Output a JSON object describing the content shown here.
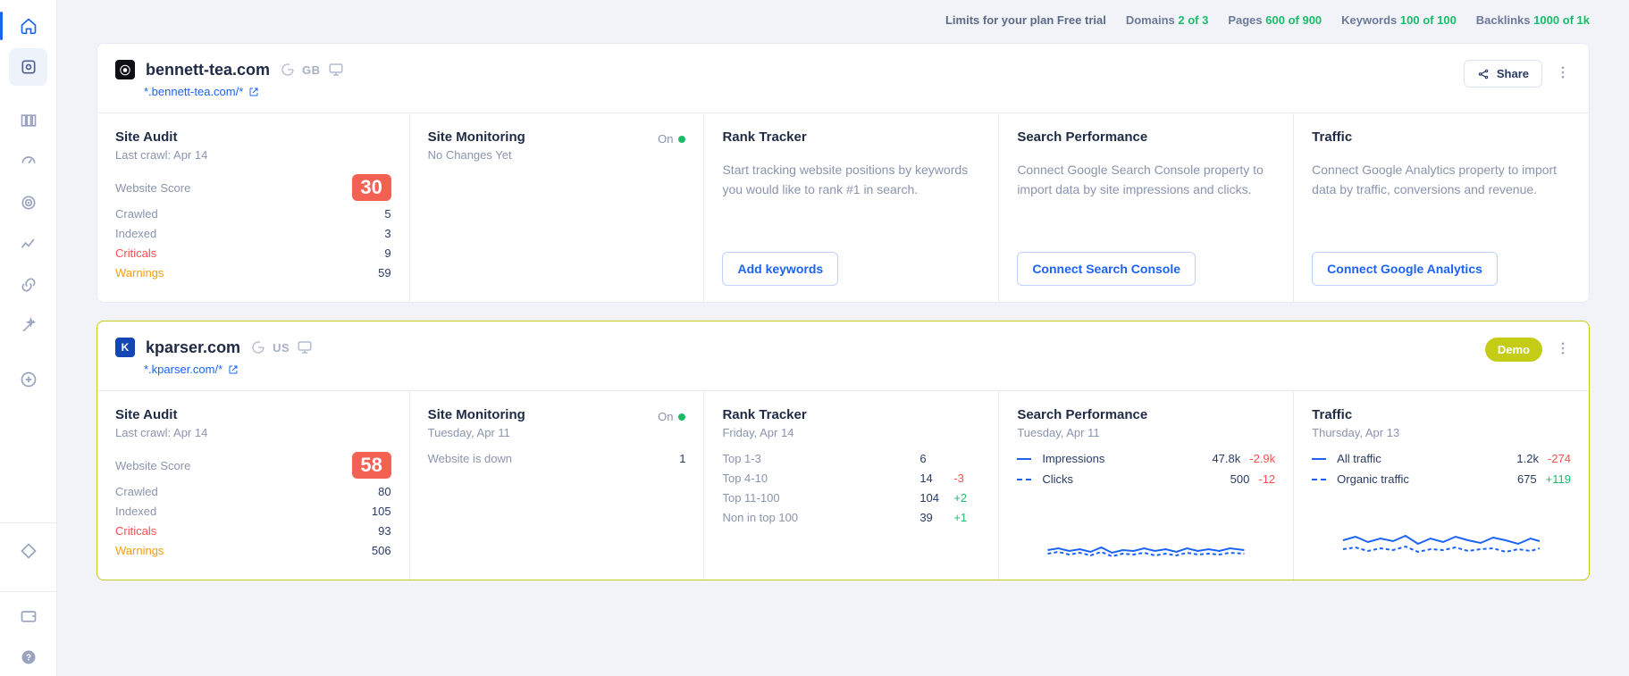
{
  "limits": {
    "lead": "Limits for your plan Free trial",
    "domains_label": "Domains",
    "domains_val": "2 of 3",
    "pages_label": "Pages",
    "pages_val": "600 of 900",
    "keywords_label": "Keywords",
    "keywords_val": "100 of 100",
    "backlinks_label": "Backlinks",
    "backlinks_val": "1000 of 1k"
  },
  "share_label": "Share",
  "cards": [
    {
      "favicon": "⦿",
      "domain": "bennett-tea.com",
      "country": "GB",
      "subdomain": "*.bennett-tea.com/*",
      "badge": null,
      "site_audit": {
        "title": "Site Audit",
        "sub": "Last crawl: Apr 14",
        "score_label": "Website Score",
        "score": "30",
        "crawled_label": "Crawled",
        "crawled": "5",
        "indexed_label": "Indexed",
        "indexed": "3",
        "criticals_label": "Criticals",
        "criticals": "9",
        "warnings_label": "Warnings",
        "warnings": "59"
      },
      "monitoring": {
        "title": "Site Monitoring",
        "status": "On",
        "sub": "No Changes Yet"
      },
      "rank": {
        "title": "Rank Tracker",
        "desc": "Start tracking website positions by keywords you would like to rank #1 in search.",
        "cta": "Add keywords"
      },
      "search": {
        "title": "Search Performance",
        "desc": "Connect Google Search Console property to import data by site impressions and clicks.",
        "cta": "Connect Search Console"
      },
      "traffic": {
        "title": "Traffic",
        "desc": "Connect Google Analytics property to import data by traffic, conversions and revenue.",
        "cta": "Connect Google Analytics"
      }
    },
    {
      "favicon": "K",
      "domain": "kparser.com",
      "country": "US",
      "subdomain": "*.kparser.com/*",
      "badge": "Demo",
      "site_audit": {
        "title": "Site Audit",
        "sub": "Last crawl: Apr 14",
        "score_label": "Website Score",
        "score": "58",
        "crawled_label": "Crawled",
        "crawled": "80",
        "indexed_label": "Indexed",
        "indexed": "105",
        "criticals_label": "Criticals",
        "criticals": "93",
        "warnings_label": "Warnings",
        "warnings": "506"
      },
      "monitoring": {
        "title": "Site Monitoring",
        "status": "On",
        "sub": "Tuesday, Apr 11",
        "row_label": "Website is down",
        "row_val": "1"
      },
      "rank": {
        "title": "Rank Tracker",
        "sub": "Friday, Apr 14",
        "rows": [
          {
            "label": "Top 1-3",
            "val": "6",
            "delta": ""
          },
          {
            "label": "Top 4-10",
            "val": "14",
            "delta": "-3"
          },
          {
            "label": "Top 11-100",
            "val": "104",
            "delta": "+2"
          },
          {
            "label": "Non in top 100",
            "val": "39",
            "delta": "+1"
          }
        ]
      },
      "search": {
        "title": "Search Performance",
        "sub": "Tuesday, Apr 11",
        "impressions_label": "Impressions",
        "impressions": "47.8k",
        "impressions_delta": "-2.9k",
        "clicks_label": "Clicks",
        "clicks": "500",
        "clicks_delta": "-12"
      },
      "traffic": {
        "title": "Traffic",
        "sub": "Thursday, Apr 13",
        "all_label": "All traffic",
        "all": "1.2k",
        "all_delta": "-274",
        "organic_label": "Organic traffic",
        "organic": "675",
        "organic_delta": "+119"
      }
    }
  ],
  "chart_data": [
    {
      "type": "line",
      "title": "Search Performance",
      "x": [
        1,
        2,
        3,
        4,
        5,
        6,
        7,
        8,
        9,
        10,
        11,
        12,
        13,
        14,
        15,
        16,
        17,
        18,
        19,
        20
      ],
      "series": [
        {
          "name": "Impressions",
          "values": [
            45,
            44,
            47,
            46,
            48,
            46,
            50,
            48,
            47,
            46,
            49,
            47,
            49,
            46,
            48,
            47,
            46,
            49,
            48,
            47
          ]
        },
        {
          "name": "Clicks",
          "values": [
            500,
            490,
            505,
            495,
            510,
            500,
            520,
            505,
            498,
            492,
            515,
            500,
            512,
            490,
            505,
            498,
            495,
            515,
            508,
            500
          ]
        }
      ]
    },
    {
      "type": "line",
      "title": "Traffic",
      "x": [
        1,
        2,
        3,
        4,
        5,
        6,
        7,
        8,
        9,
        10,
        11,
        12,
        13,
        14,
        15,
        16,
        17,
        18,
        19,
        20
      ],
      "series": [
        {
          "name": "All traffic",
          "values": [
            1250,
            1300,
            1220,
            1260,
            1240,
            1310,
            1180,
            1260,
            1200,
            1290,
            1240,
            1210,
            1280,
            1300,
            1230,
            1260,
            1200,
            1270,
            1290,
            1220
          ]
        },
        {
          "name": "Organic traffic",
          "values": [
            680,
            660,
            700,
            670,
            690,
            650,
            710,
            670,
            690,
            660,
            700,
            680,
            665,
            705,
            670,
            690,
            655,
            700,
            680,
            695
          ]
        }
      ]
    }
  ]
}
